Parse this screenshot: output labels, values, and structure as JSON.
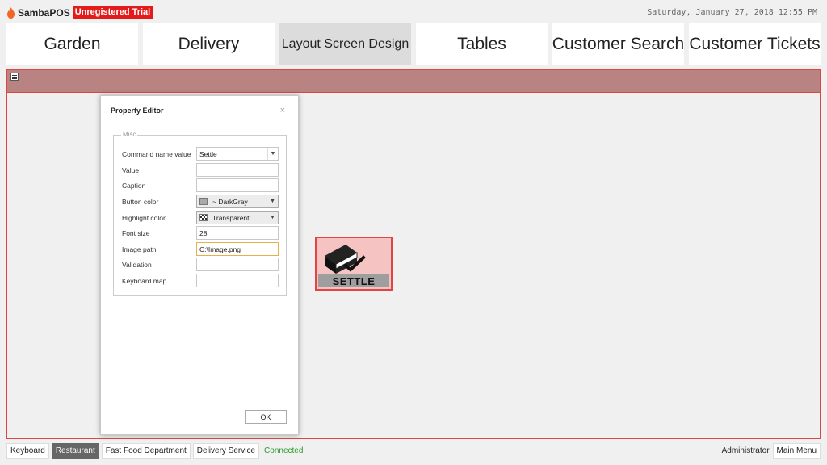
{
  "header": {
    "app_name": "SambaPOS",
    "trial_badge": "Unregistered Trial",
    "datetime": "Saturday, January 27, 2018 12:55 PM"
  },
  "tabs": [
    {
      "label": "Garden"
    },
    {
      "label": "Delivery"
    },
    {
      "label": "Layout Screen Design",
      "active": true
    },
    {
      "label": "Tables"
    },
    {
      "label": "Customer Search"
    },
    {
      "label": "Customer Tickets"
    }
  ],
  "property_editor": {
    "title": "Property Editor",
    "close_glyph": "×",
    "group_label": "Misc",
    "fields": [
      {
        "name": "Command name value",
        "value": "Settle"
      },
      {
        "name": "Value",
        "value": ""
      },
      {
        "name": "Caption",
        "value": ""
      },
      {
        "name": "Button color",
        "value": "~ DarkGray"
      },
      {
        "name": "Highlight color",
        "value": "Transparent"
      },
      {
        "name": "Font size",
        "value": "28"
      },
      {
        "name": "Image path",
        "value": "C:\\Image.png"
      },
      {
        "name": "Validation",
        "value": ""
      },
      {
        "name": "Keyboard map",
        "value": ""
      }
    ],
    "ok_label": "OK"
  },
  "settle_button": {
    "label": "SETTLE"
  },
  "statusbar": {
    "left": [
      "Keyboard",
      "Restaurant",
      "Fast Food Department",
      "Delivery Service"
    ],
    "active_index": 1,
    "connection": "Connected",
    "user": "Administrator",
    "main_menu": "Main Menu"
  },
  "colors": {
    "accent_red": "#e04545",
    "strip": "#b98382",
    "settle_bg": "#f6c3c3",
    "connected": "#2d9a2d"
  }
}
